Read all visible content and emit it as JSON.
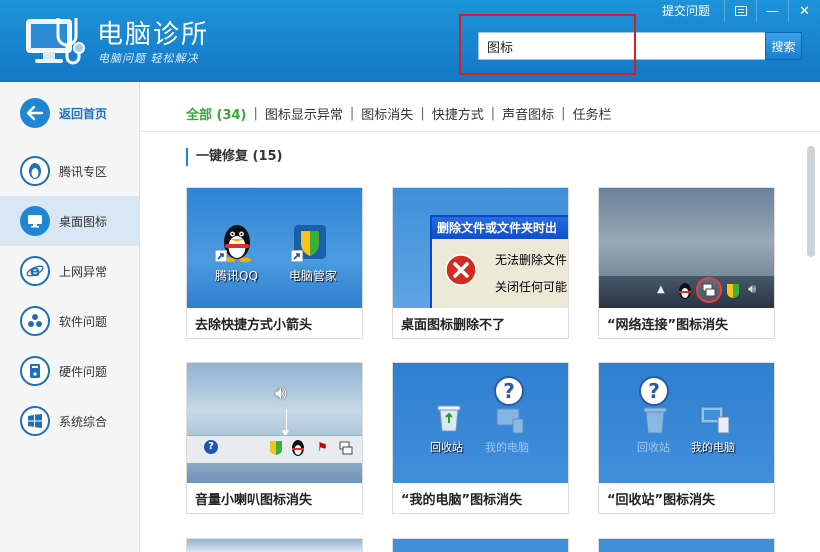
{
  "app": {
    "title": "电脑诊所",
    "slogan": "电脑问题 轻松解决"
  },
  "window": {
    "feedback_label": "提交问题",
    "minimize_symbol": "—",
    "close_symbol": "✕"
  },
  "search": {
    "value": "图标",
    "button_label": "搜索"
  },
  "sidebar": {
    "items": [
      {
        "label": "返回首页",
        "icon": "back-arrow-icon"
      },
      {
        "label": "腾讯专区",
        "icon": "penguin-icon"
      },
      {
        "label": "桌面图标",
        "icon": "monitor-icon"
      },
      {
        "label": "上网异常",
        "icon": "ie-browser-icon"
      },
      {
        "label": "软件问题",
        "icon": "software-icon"
      },
      {
        "label": "硬件问题",
        "icon": "hardware-icon"
      },
      {
        "label": "系统综合",
        "icon": "windows-icon"
      }
    ]
  },
  "filters": {
    "tabs": [
      {
        "label": "全部 (34)",
        "active": true
      },
      {
        "label": "图标显示异常"
      },
      {
        "label": "图标消失"
      },
      {
        "label": "快捷方式"
      },
      {
        "label": "声音图标"
      },
      {
        "label": "任务栏"
      }
    ],
    "separator": "|"
  },
  "section": {
    "title": "一键修复 (15)"
  },
  "cards": [
    {
      "caption": "去除快捷方式小箭头",
      "thumb_labels": [
        "腾讯QQ",
        "电脑管家"
      ]
    },
    {
      "caption": "桌面图标删除不了",
      "thumb_labels": [
        "删除文件或文件夹时出",
        "无法删除文件",
        "关闭任何可能"
      ]
    },
    {
      "caption": "“网络连接”图标消失",
      "thumb_labels": []
    },
    {
      "caption": "音量小喇叭图标消失",
      "thumb_labels": []
    },
    {
      "caption": "“我的电脑”图标消失",
      "thumb_labels": [
        "回收站",
        "我的电脑"
      ]
    },
    {
      "caption": "“回收站”图标消失",
      "thumb_labels": [
        "回收站",
        "我的电脑"
      ]
    }
  ],
  "colors": {
    "header_blue": "#1a86d2",
    "active_filter_green": "#36a736",
    "highlight_red": "#e0191d"
  }
}
